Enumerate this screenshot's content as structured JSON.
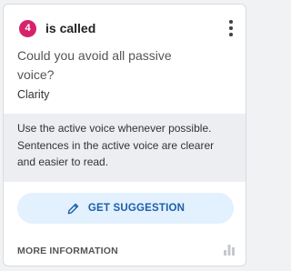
{
  "card": {
    "badge_count": "4",
    "title": "is called",
    "question": "Could you avoid all passive voice?",
    "category": "Clarity",
    "explanation": "Use the active voice whenever possible. Sentences in the active voice are clearer and easier to read.",
    "suggestion_button_label": "GET SUGGESTION",
    "more_info_label": "MORE INFORMATION"
  },
  "icons": {
    "menu": "more-vertical-icon",
    "pencil": "pencil-icon",
    "stats": "bar-chart-icon"
  },
  "colors": {
    "badge": "#d6226b",
    "accent_button_bg": "#e3f0fd",
    "accent_button_text": "#1a5fad",
    "explanation_bg": "#eceef1"
  }
}
